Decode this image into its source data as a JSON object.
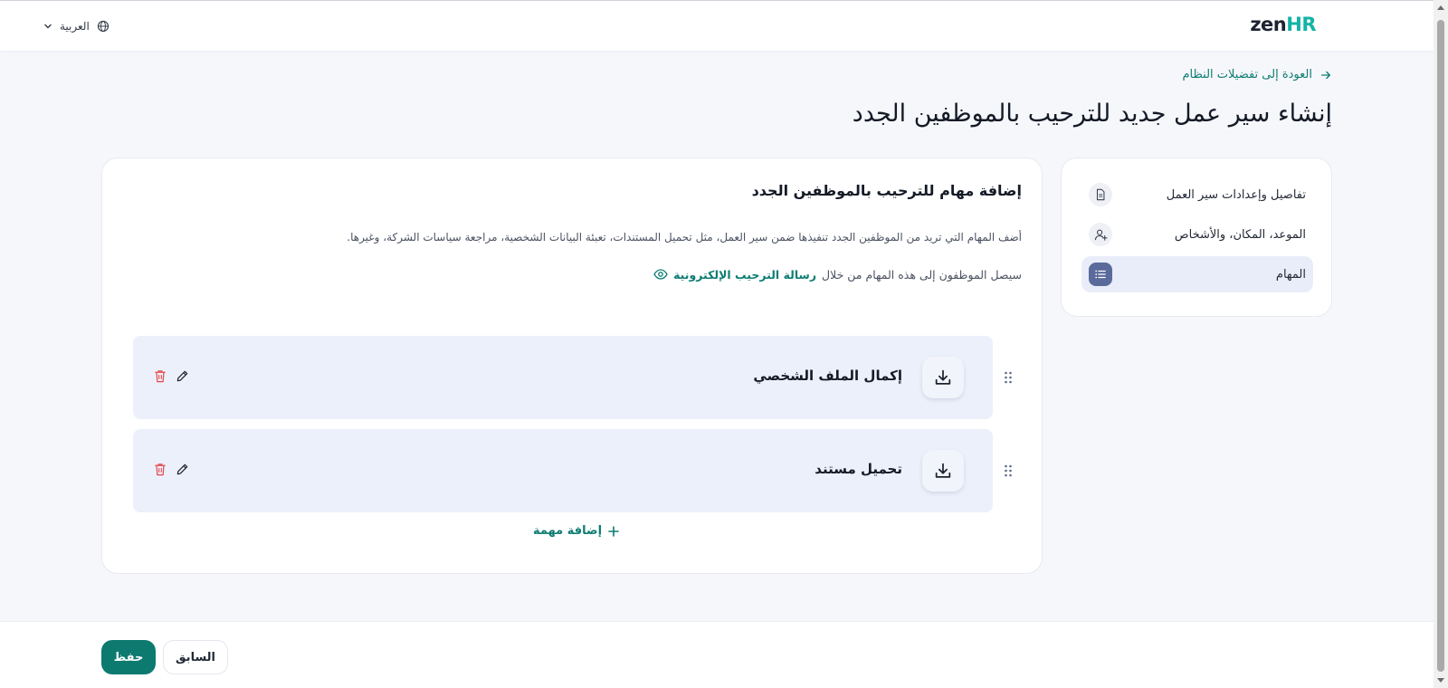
{
  "header": {
    "logo_zen": "zen",
    "logo_hr": "HR",
    "language": "العربية"
  },
  "nav": {
    "back_label": "العودة إلى تفضيلات النظام"
  },
  "page": {
    "title": "إنشاء سير عمل جديد للترحيب بالموظفين الجدد"
  },
  "steps": [
    {
      "label": "تفاصيل وإعدادات سير العمل",
      "icon": "document-icon",
      "active": false
    },
    {
      "label": "الموعد، المكان، والأشخاص",
      "icon": "add-user-icon",
      "active": false
    },
    {
      "label": "المهام",
      "icon": "list-icon",
      "active": true
    }
  ],
  "section": {
    "title": "إضافة مهام للترحيب بالموظفين الجدد",
    "description": "أضف المهام التي تريد من الموظفين الجدد تنفيذها ضمن سير العمل، مثل تحميل المستندات، تعبئة البيانات الشخصية، مراجعة سياسات الشركة، وغيرها.",
    "notice_prefix": "سيصل الموظفون إلى هذه المهام من خلال",
    "notice_link": "رسالة الترحيب الإلكترونية"
  },
  "tasks": [
    {
      "name": "إكمال الملف الشخصي",
      "icon": "download-icon"
    },
    {
      "name": "تحميل مستند",
      "icon": "download-icon"
    }
  ],
  "add_task_label": "إضافة مهمة",
  "footer": {
    "save_label": "حفظ",
    "previous_label": "السابق"
  },
  "colors": {
    "brand_teal": "#0d7a70",
    "logo_accent": "#12b3a6",
    "active_step_bg": "#e9edf9",
    "task_bg": "#ecf0fb",
    "delete_red": "#e5484d"
  }
}
